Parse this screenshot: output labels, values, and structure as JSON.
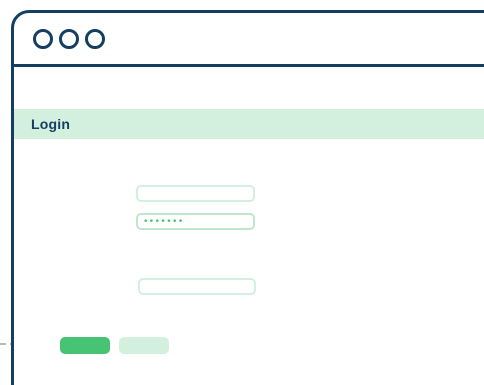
{
  "window": {
    "controls": [
      {
        "icon": "window-dot-icon"
      },
      {
        "icon": "window-dot-icon"
      },
      {
        "icon": "window-dot-icon"
      }
    ]
  },
  "login": {
    "title": "Login",
    "username": {
      "value": "",
      "placeholder": ""
    },
    "password": {
      "value": "•••••••",
      "mask": "•••••••"
    },
    "extra_field": {
      "value": ""
    },
    "primary_button": {
      "label": ""
    },
    "secondary_button": {
      "label": ""
    }
  },
  "colors": {
    "frame": "#143f63",
    "band": "#d3efdd",
    "accent": "#46c373",
    "muted": "#d3efdd",
    "connector": "#b8b8b8"
  }
}
